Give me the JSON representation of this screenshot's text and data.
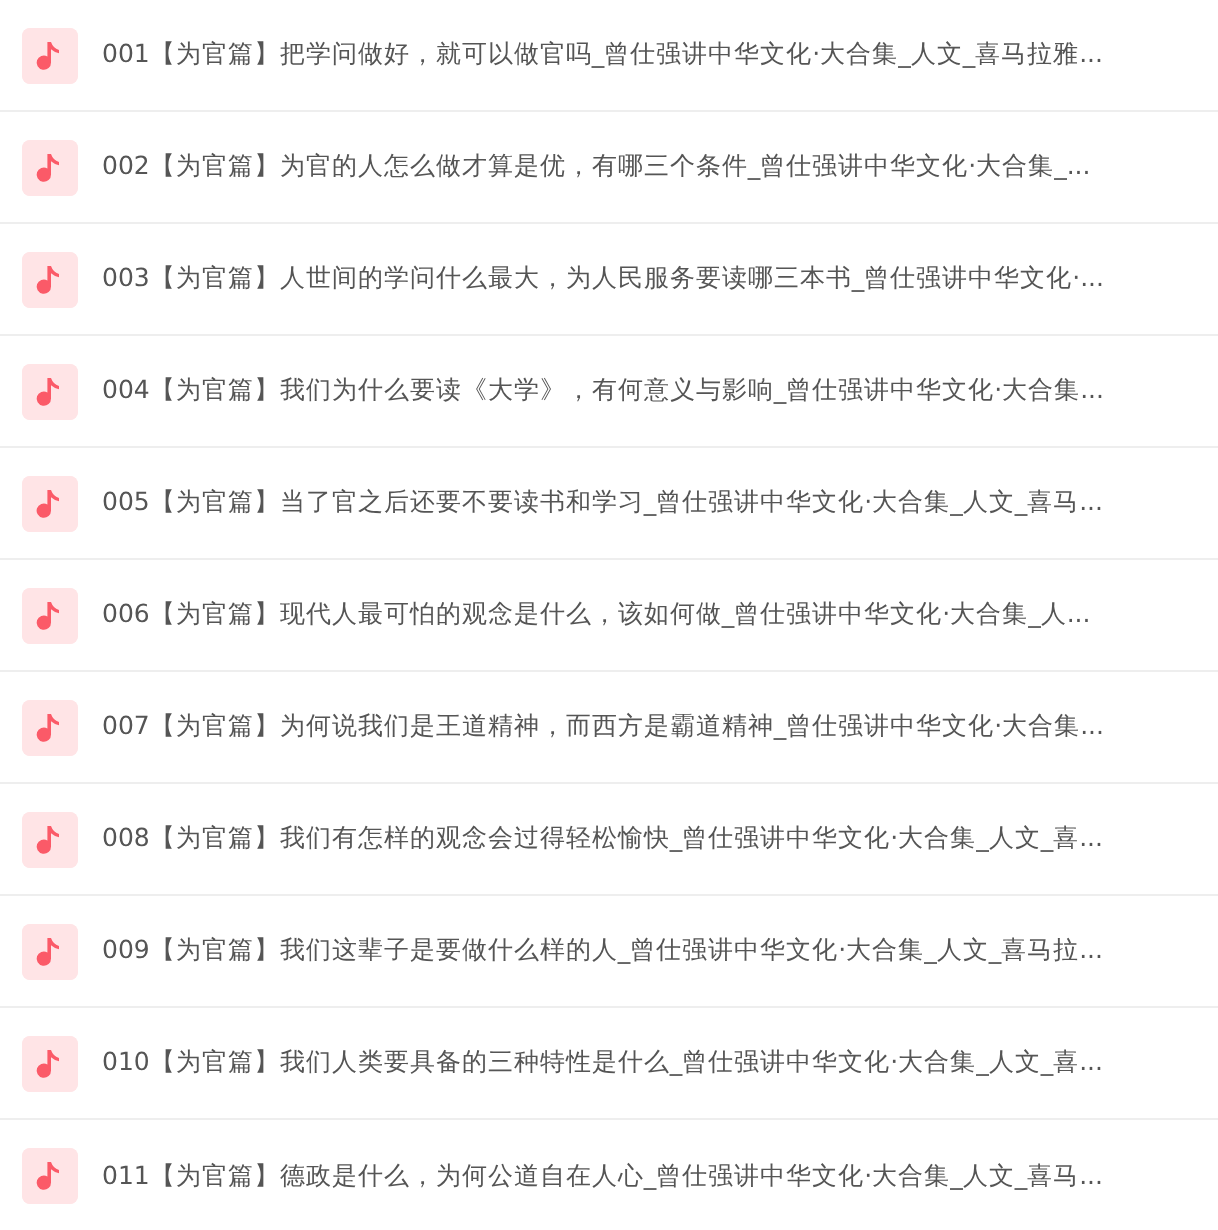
{
  "tracks": [
    {
      "title": "001【为官篇】把学问做好，就可以做官吗_曾仕强讲中华文化·大合集_人文_喜马拉雅..."
    },
    {
      "title": "002【为官篇】为官的人怎么做才算是优，有哪三个条件_曾仕强讲中华文化·大合集_..."
    },
    {
      "title": "003【为官篇】人世间的学问什么最大，为人民服务要读哪三本书_曾仕强讲中华文化·..."
    },
    {
      "title": "004【为官篇】我们为什么要读《大学》，有何意义与影响_曾仕强讲中华文化·大合集..."
    },
    {
      "title": "005【为官篇】当了官之后还要不要读书和学习_曾仕强讲中华文化·大合集_人文_喜马..."
    },
    {
      "title": "006【为官篇】现代人最可怕的观念是什么，该如何做_曾仕强讲中华文化·大合集_人..."
    },
    {
      "title": "007【为官篇】为何说我们是王道精神，而西方是霸道精神_曾仕强讲中华文化·大合集..."
    },
    {
      "title": "008【为官篇】我们有怎样的观念会过得轻松愉快_曾仕强讲中华文化·大合集_人文_喜..."
    },
    {
      "title": "009【为官篇】我们这辈子是要做什么样的人_曾仕强讲中华文化·大合集_人文_喜马拉..."
    },
    {
      "title": "010【为官篇】我们人类要具备的三种特性是什么_曾仕强讲中华文化·大合集_人文_喜..."
    },
    {
      "title": "011【为官篇】德政是什么，为何公道自在人心_曾仕强讲中华文化·大合集_人文_喜马..."
    }
  ]
}
